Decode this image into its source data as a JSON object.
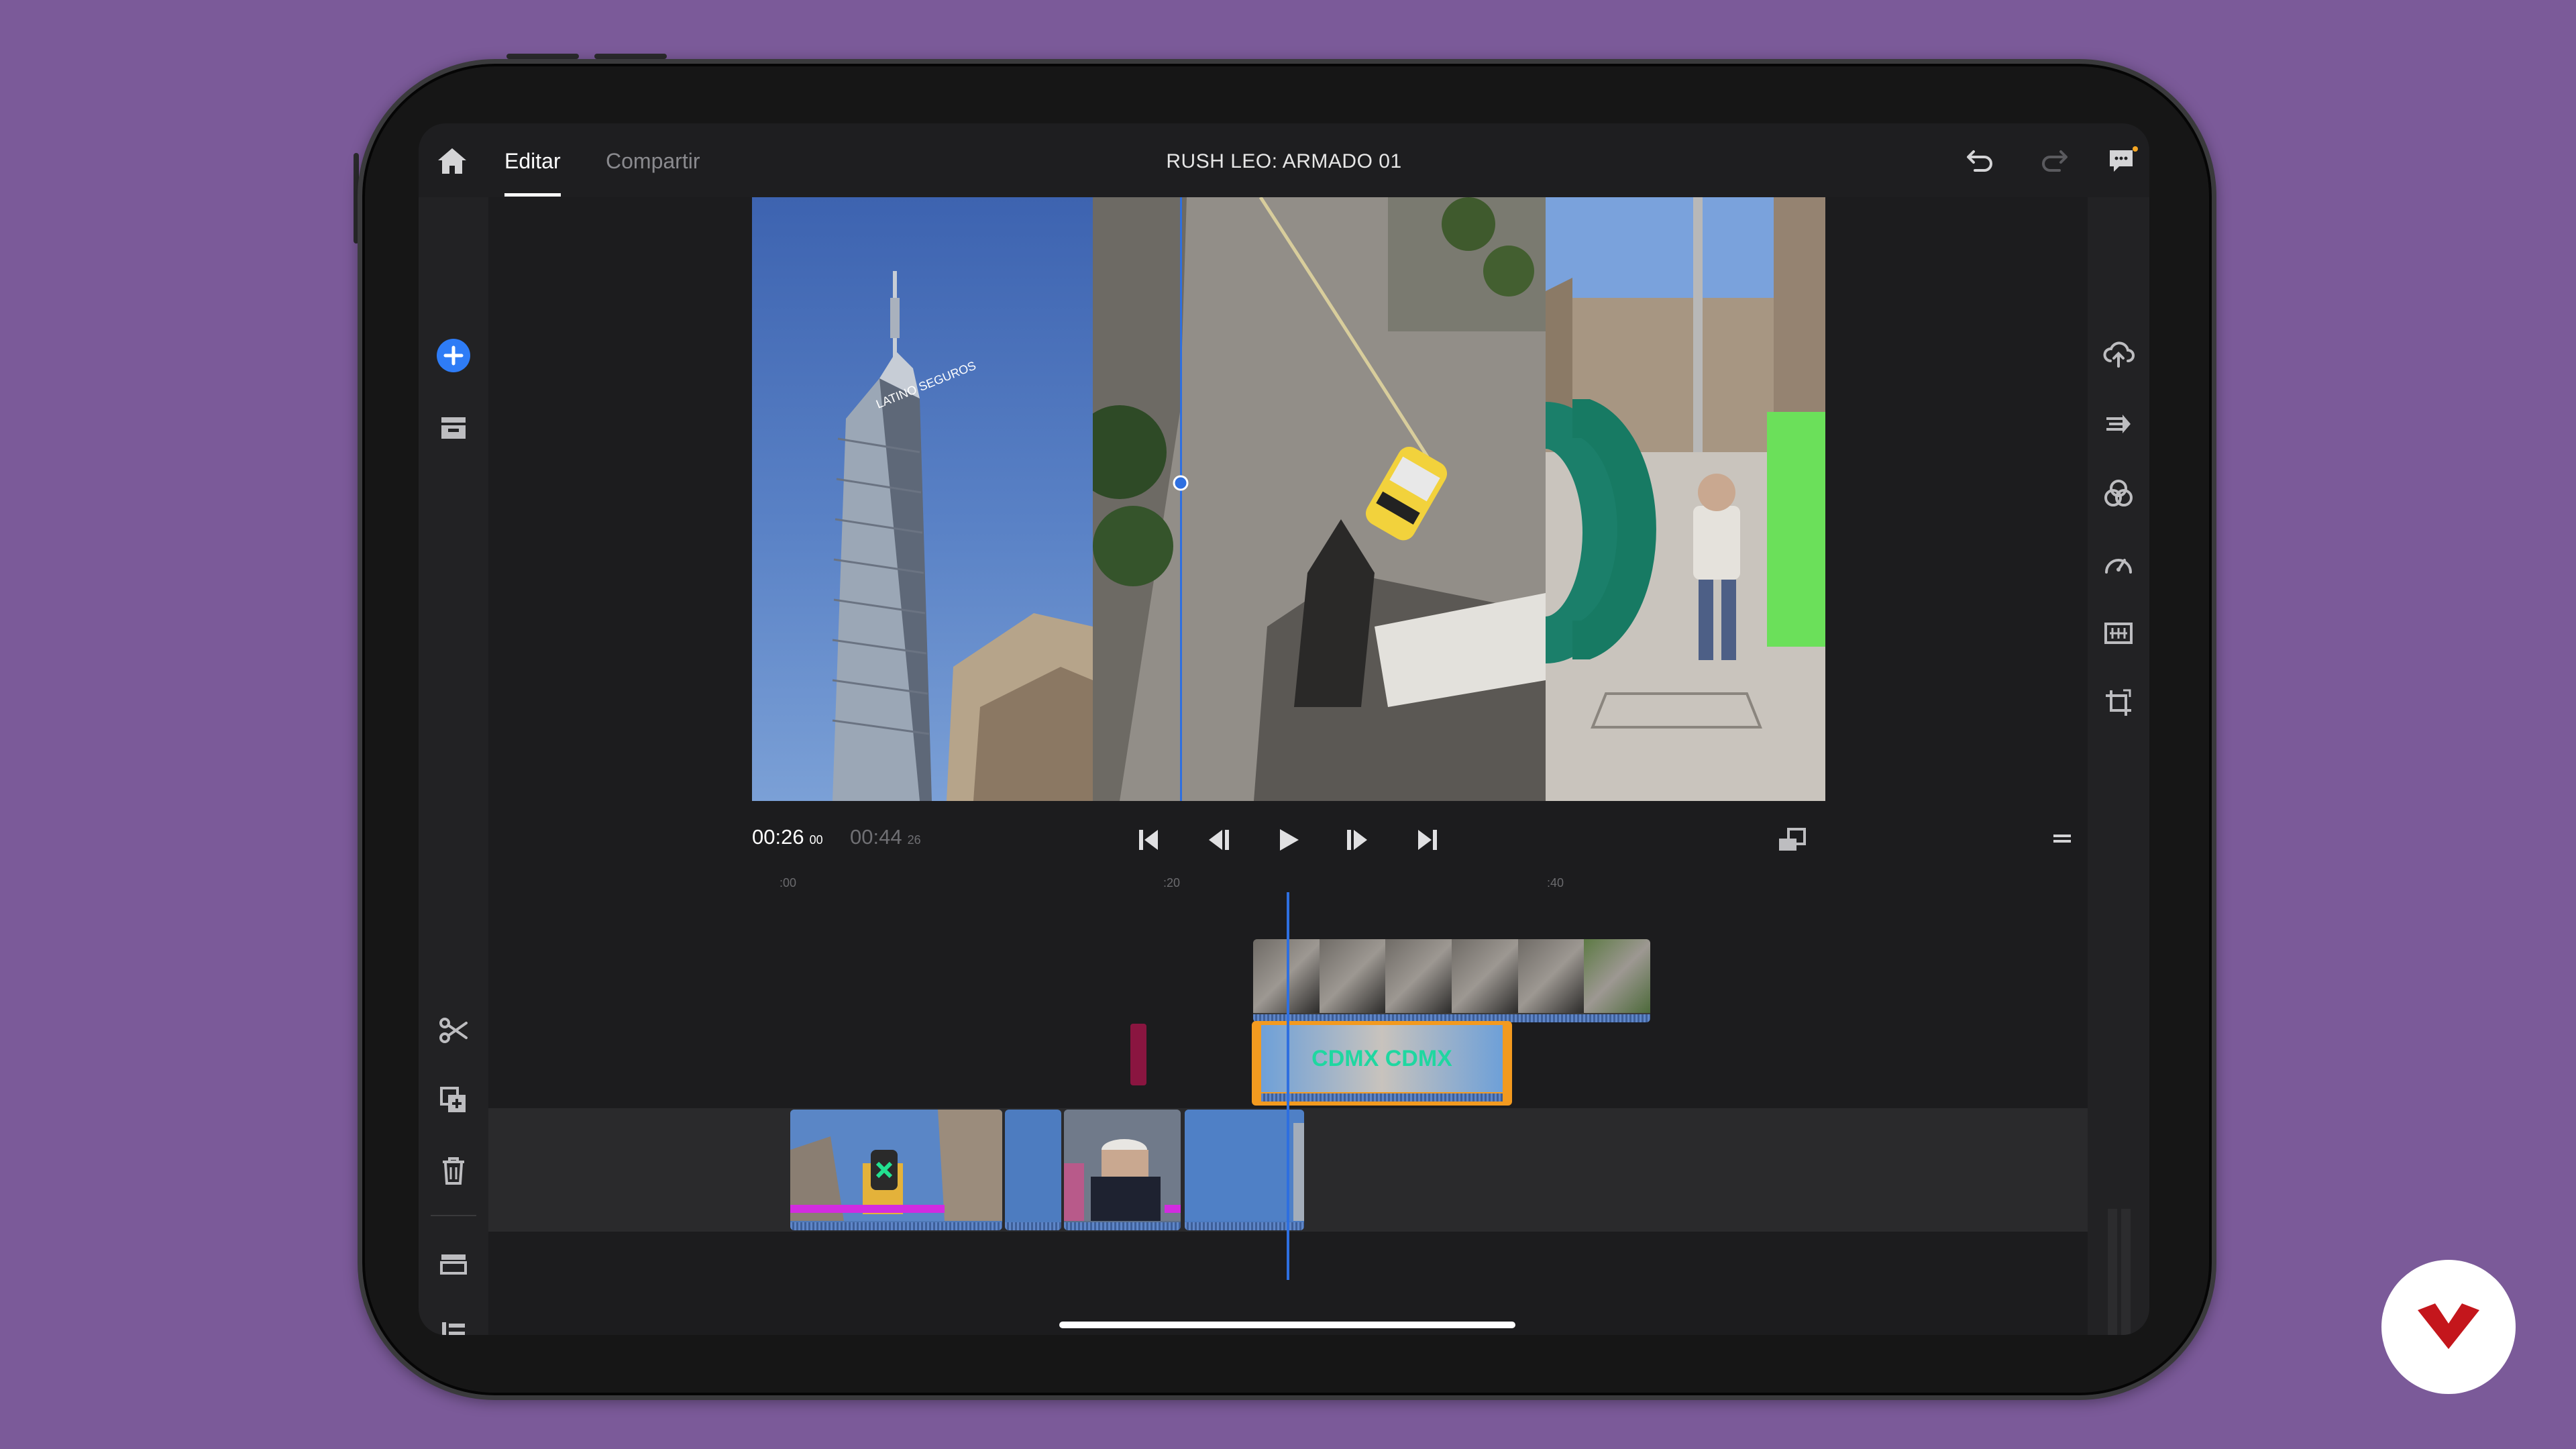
{
  "header": {
    "tabs": [
      {
        "label": "Editar",
        "active": true
      },
      {
        "label": "Compartir",
        "active": false
      }
    ],
    "project_title": "RUSH LEO: ARMADO 01"
  },
  "playback": {
    "current_time": "00:26",
    "current_frames": "00",
    "total_time": "00:44",
    "total_frames": "26"
  },
  "ruler": {
    "labels": [
      ":00",
      ":20",
      ":40"
    ]
  },
  "left_tools": [
    "add-icon",
    "media-icon",
    "scissors-icon",
    "duplicate-icon",
    "trash-icon",
    "tracks-icon",
    "list-icon",
    "add-media-icon"
  ],
  "right_tools": [
    "cloud-upload-icon",
    "transition-icon",
    "color-icon",
    "speed-icon",
    "audio-levels-icon",
    "crop-icon"
  ],
  "preview_clips": [
    {
      "name": "torre-latinoamericana",
      "label": "LATINO SEGUROS"
    },
    {
      "name": "street-aerial"
    },
    {
      "name": "cdmx-sign"
    }
  ],
  "timeline": {
    "overlay_track_1": {
      "start_sec": 24.5,
      "end_sec": 45.2
    },
    "overlay_track_2": {
      "start_sec": 24.5,
      "end_sec": 38.0,
      "selected": true,
      "label": "CDMX CDMX"
    },
    "marker": {
      "at_sec": 18.0
    },
    "main_track": [
      {
        "start_sec": 0.0,
        "end_sec": 11.2
      },
      {
        "start_sec": 11.4,
        "end_sec": 14.4
      },
      {
        "start_sec": 14.6,
        "end_sec": 20.7
      },
      {
        "start_sec": 20.9,
        "end_sec": 27.1
      }
    ]
  },
  "colors": {
    "accent_blue": "#2e6fe0",
    "selection_orange": "#f39a1f",
    "marker_magenta": "#8a1540",
    "background_purple": "#7b5a99",
    "logo_red": "#c4161c"
  }
}
